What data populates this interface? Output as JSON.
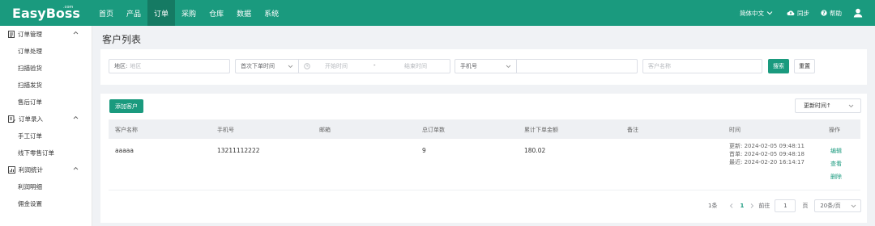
{
  "brand": {
    "logo": "EasyBoss",
    "logo_sup": ".com"
  },
  "nav": {
    "items": [
      "首页",
      "产品",
      "订单",
      "采购",
      "仓库",
      "数据",
      "系统"
    ],
    "active_index": 2
  },
  "top_right": {
    "language": "简体中文",
    "sync": "同步",
    "help": "帮助"
  },
  "sidebar": {
    "groups": [
      {
        "label": "订单管理",
        "items": [
          "订单处理",
          "扫描验货",
          "扫描发货",
          "售后订单"
        ]
      },
      {
        "label": "订单录入",
        "items": [
          "手工订单",
          "线下零售订单"
        ]
      },
      {
        "label": "利润统计",
        "items": [
          "利润明细",
          "佣金设置"
        ]
      }
    ]
  },
  "page": {
    "title": "客户列表"
  },
  "filters": {
    "region_label": "地区:",
    "region_placeholder": "地区",
    "time_type": "首次下单时间",
    "start_placeholder": "开始时间",
    "range_sep": "-",
    "end_placeholder": "结束时间",
    "phone_type": "手机号",
    "customer_placeholder": "客户名称",
    "search_btn": "搜索",
    "reset_btn": "重置"
  },
  "toolbar": {
    "add_btn": "添加客户",
    "sort_label": "更新时间↑"
  },
  "table": {
    "columns": [
      "客户名称",
      "手机号",
      "邮箱",
      "总订单数",
      "累计下单金额",
      "备注",
      "时间",
      "操作"
    ],
    "rows": [
      {
        "name": "aaaaa",
        "phone": "13211112222",
        "email": "",
        "orders": "9",
        "amount": "180.02",
        "note": "",
        "time_updated": "更新: 2024-02-05 09:48:11",
        "time_first": "首单: 2024-02-05 09:48:18",
        "time_recent": "最近: 2024-02-20 16:14:17",
        "actions": [
          "编辑",
          "查看",
          "删除"
        ]
      }
    ]
  },
  "pagination": {
    "total": "1条",
    "current": "1",
    "goto_label": "前往",
    "goto_value": "1",
    "page_unit": "页",
    "page_size": "20条/页"
  }
}
